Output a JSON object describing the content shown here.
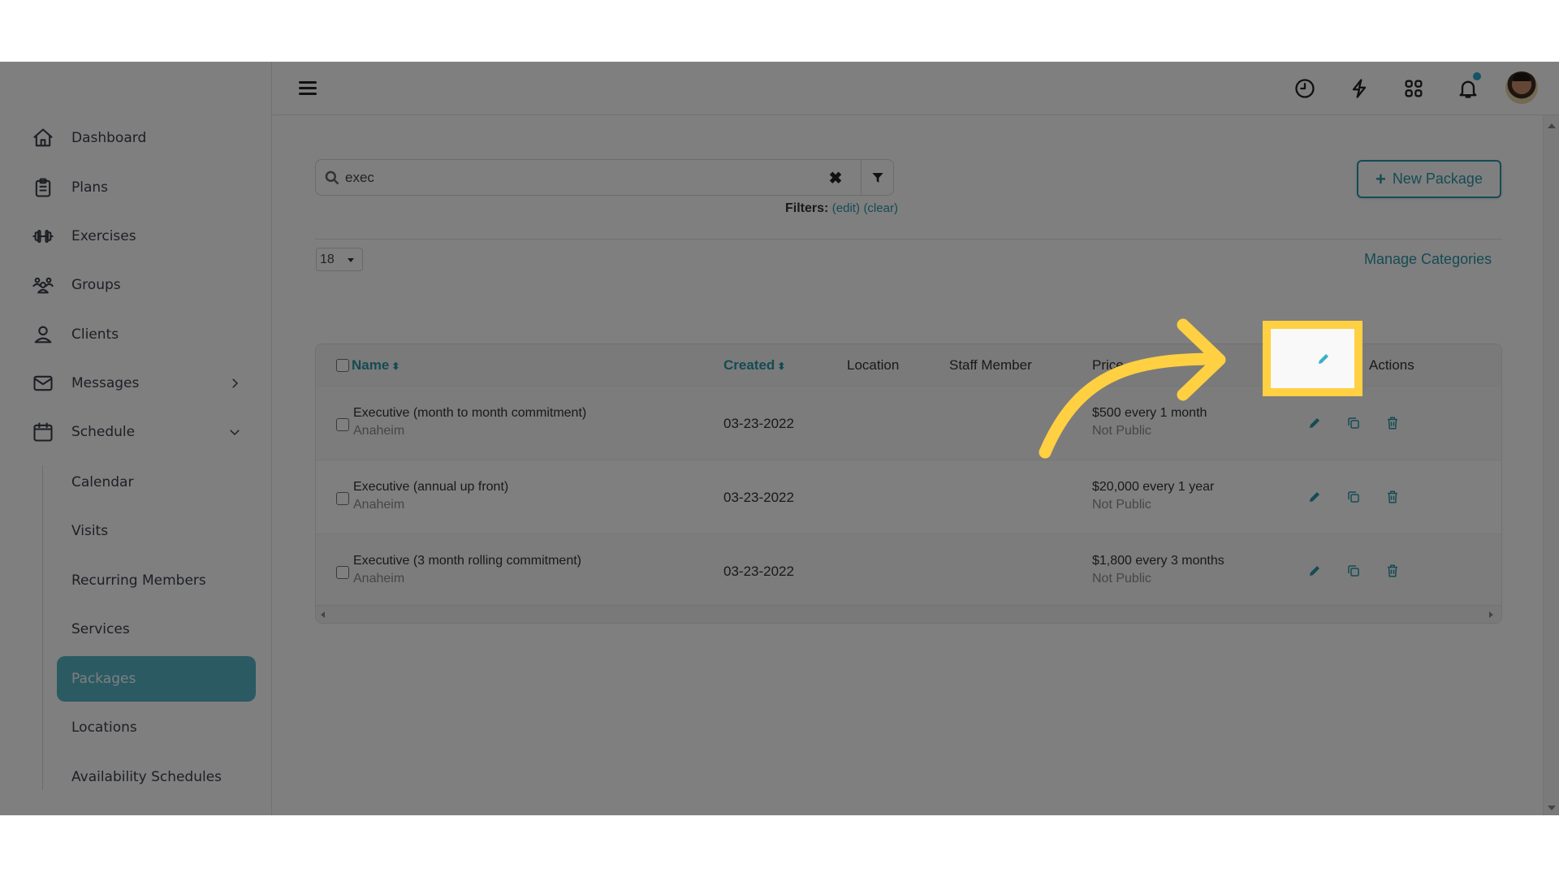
{
  "sidebar": {
    "items": [
      {
        "label": "Dashboard",
        "icon": "home-icon"
      },
      {
        "label": "Plans",
        "icon": "clipboard-icon"
      },
      {
        "label": "Exercises",
        "icon": "dumbbell-icon"
      },
      {
        "label": "Groups",
        "icon": "users-icon"
      },
      {
        "label": "Clients",
        "icon": "user-icon"
      },
      {
        "label": "Messages",
        "icon": "envelope-icon",
        "chevron": "chevron-right-icon"
      },
      {
        "label": "Schedule",
        "icon": "calendar-icon",
        "chevron": "chevron-down-icon"
      }
    ],
    "schedule_sub": [
      {
        "label": "Calendar"
      },
      {
        "label": "Visits"
      },
      {
        "label": "Recurring Members"
      },
      {
        "label": "Services"
      },
      {
        "label": "Packages",
        "active": true
      },
      {
        "label": "Locations"
      },
      {
        "label": "Availability Schedules"
      }
    ]
  },
  "header": {
    "icons": [
      "menu-icon",
      "clock-icon",
      "lightning-icon",
      "apps-grid-icon",
      "bell-icon",
      "avatar"
    ],
    "notification_dot_color": "#2aa9c9"
  },
  "search": {
    "value": "exec",
    "clear_symbol": "✖",
    "filters_label": "Filters:",
    "edit_link": "(edit)",
    "clear_link": "(clear)"
  },
  "toolbar": {
    "new_package_label": "New Package",
    "new_package_plus": "+",
    "per_page": "18",
    "manage_categories": "Manage Categories"
  },
  "table": {
    "columns": {
      "name": "Name",
      "created": "Created",
      "location": "Location",
      "staff": "Staff Member",
      "price": "Price",
      "actions": "Actions",
      "sort_symbol": "⬍"
    },
    "rows": [
      {
        "name": "Executive (month to month commitment)",
        "location": "Anaheim",
        "created": "03-23-2022",
        "price": "$500 every 1 month",
        "visibility": "Not Public"
      },
      {
        "name": "Executive (annual up front)",
        "location": "Anaheim",
        "created": "03-23-2022",
        "price": "$20,000 every 1 year",
        "visibility": "Not Public"
      },
      {
        "name": "Executive (3 month rolling commitment)",
        "location": "Anaheim",
        "created": "03-23-2022",
        "price": "$1,800 every 3 months",
        "visibility": "Not Public"
      }
    ]
  },
  "colors": {
    "accent": "#2b97a9",
    "active_nav": "#56b4c6",
    "highlight": "#ffd042",
    "overlay": "rgba(0,0,0,0.5)"
  },
  "annotation": {
    "target": "edit-button row 1",
    "arrow": "curved-arrow-right"
  }
}
